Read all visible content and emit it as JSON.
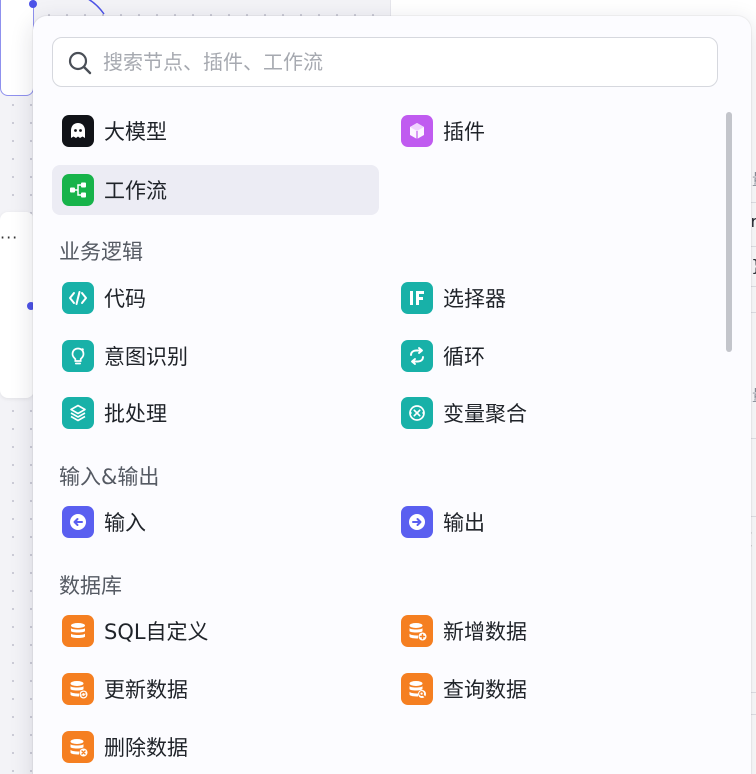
{
  "search": {
    "placeholder": "搜索节点、插件、工作流"
  },
  "top_items": [
    {
      "label": "大模型",
      "icon": "llm-ghost-icon",
      "color": "#111318"
    },
    {
      "label": "插件",
      "icon": "plugin-cube-icon",
      "color": "#c05bf0"
    },
    {
      "label": "工作流",
      "icon": "workflow-nodes-icon",
      "color": "#17b34a",
      "selected": true
    }
  ],
  "sections": [
    {
      "title": "业务逻辑",
      "items": [
        {
          "label": "代码",
          "icon": "code-icon",
          "color": "#18b1a8"
        },
        {
          "label": "选择器",
          "icon": "if-selector-icon",
          "color": "#18b1a8"
        },
        {
          "label": "意图识别",
          "icon": "intent-bulb-icon",
          "color": "#18b1a8"
        },
        {
          "label": "循环",
          "icon": "loop-icon",
          "color": "#18b1a8"
        },
        {
          "label": "批处理",
          "icon": "batch-layers-icon",
          "color": "#18b1a8"
        },
        {
          "label": "变量聚合",
          "icon": "variable-merge-icon",
          "color": "#18b1a8"
        }
      ]
    },
    {
      "title": "输入&输出",
      "items": [
        {
          "label": "输入",
          "icon": "input-arrow-icon",
          "color": "#5a5ff0"
        },
        {
          "label": "输出",
          "icon": "output-arrow-icon",
          "color": "#5a5ff0"
        }
      ]
    },
    {
      "title": "数据库",
      "items": [
        {
          "label": "SQL自定义",
          "icon": "database-icon",
          "color": "#f57f21"
        },
        {
          "label": "新增数据",
          "icon": "database-add-icon",
          "color": "#f57f21"
        },
        {
          "label": "更新数据",
          "icon": "database-update-icon",
          "color": "#f57f21"
        },
        {
          "label": "查询数据",
          "icon": "database-search-icon",
          "color": "#f57f21"
        },
        {
          "label": "删除数据",
          "icon": "database-delete-icon",
          "color": "#f57f21"
        }
      ]
    }
  ],
  "background": {
    "node_more": "···",
    "right_panel_fragments": [
      "变量",
      "str",
      "{ }",
      "变量",
      "频"
    ]
  }
}
